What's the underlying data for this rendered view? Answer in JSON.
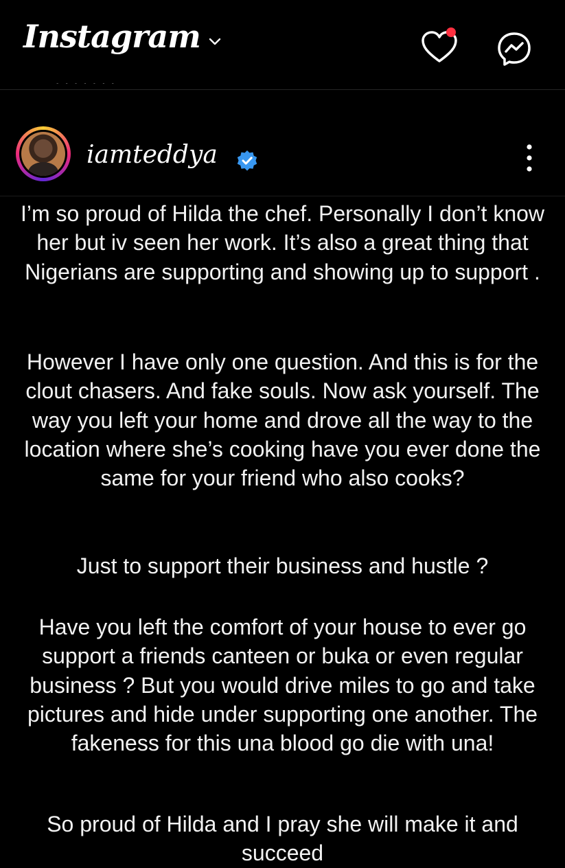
{
  "app": {
    "title": "Instagram",
    "title_dropdown_icon": "chevron-down-icon",
    "has_notification_dot": true,
    "notification_dot_color": "#ff3040",
    "heart_icon": "heart-icon",
    "messenger_icon": "messenger-icon"
  },
  "post": {
    "username": "iamteddya",
    "verified": true,
    "verified_color": "#3897f0",
    "more_icon": "more-vertical-icon",
    "paragraphs": [
      "I’m so proud of Hilda the chef. Personally I don’t know her but iv seen her work. It’s also a great thing that Nigerians are supporting and showing up to support .",
      "However I have only one question. And this is for the clout chasers. And fake souls. Now ask yourself. The way you left your home and drove all the way to the location where she’s cooking have you ever done the same for your friend who also cooks?",
      "Just to support their business and hustle ?",
      "Have you left the comfort of your house to ever go support a friends canteen or buka or even regular business ? But you would drive miles to go and take pictures and hide under supporting one another. The fakeness for this una blood go die with una!",
      "So proud of Hilda and I pray she will make it and succeed"
    ]
  }
}
